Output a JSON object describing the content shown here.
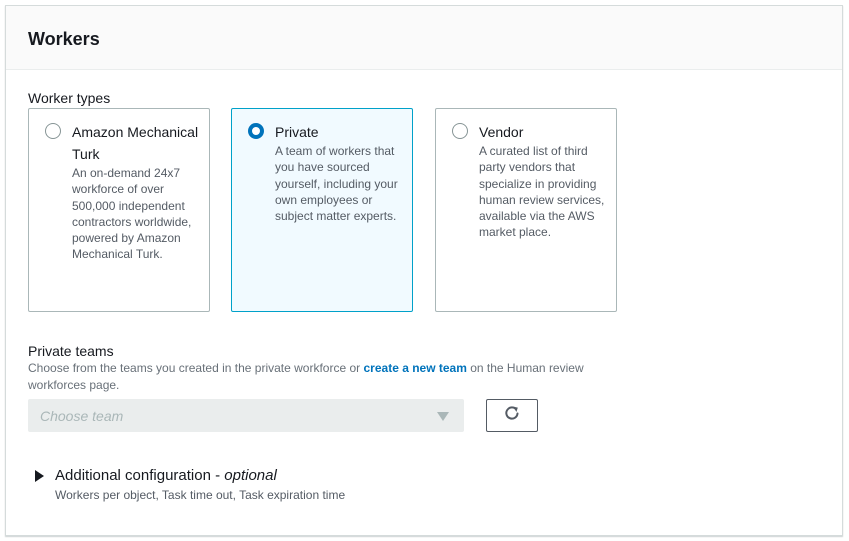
{
  "panel": {
    "title": "Workers"
  },
  "worker_types": {
    "label": "Worker types",
    "options": [
      {
        "title": "Amazon Mechanical Turk",
        "description": "An on-demand 24x7 workforce of over 500,000 independent contractors worldwide, powered by Amazon Mechanical Turk.",
        "selected": false
      },
      {
        "title": "Private",
        "description": "A team of workers that you have sourced yourself, including your own employees or subject matter experts.",
        "selected": true
      },
      {
        "title": "Vendor",
        "description": "A curated list of third party vendors that specialize in providing human review services, available via the AWS market place.",
        "selected": false
      }
    ]
  },
  "private_teams": {
    "label": "Private teams",
    "desc_before": "Choose from the teams you created in the private workforce or ",
    "desc_link": "create a new team",
    "desc_after": " on the Human review workforces page.",
    "select_placeholder": "Choose team",
    "refresh_icon": "refresh-icon"
  },
  "additional_config": {
    "title": "Additional configuration - ",
    "optional": "optional",
    "description": "Workers per object, Task time out, Task expiration time",
    "icon": "caret-right-icon"
  },
  "colors": {
    "accent": "#0073bb",
    "selected_border": "#00a1c9",
    "selected_bg": "#f1faff",
    "text": "#16191f",
    "muted": "#545b64"
  }
}
